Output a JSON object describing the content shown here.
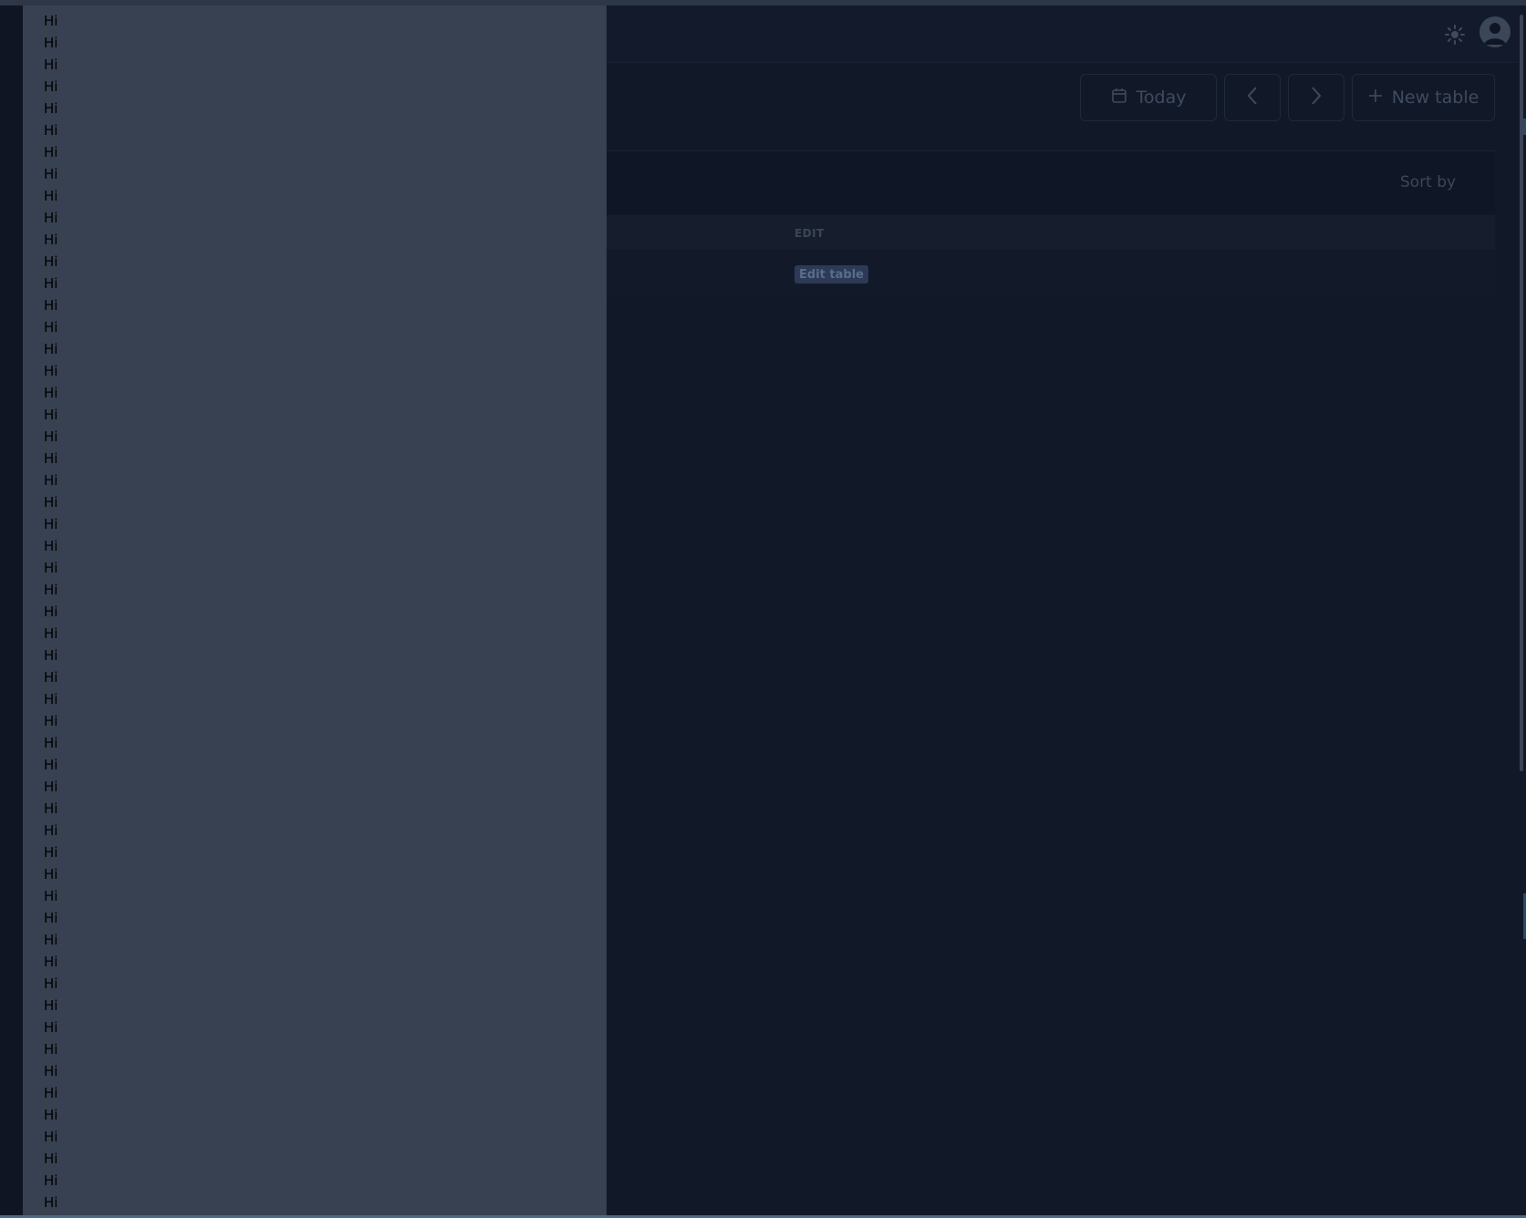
{
  "header": {
    "theme_icon": "sun-icon",
    "avatar_icon": "user-avatar-icon"
  },
  "toolbar": {
    "today_label": "Today",
    "today_icon": "calendar-icon",
    "prev_icon": "chevron-left-icon",
    "next_icon": "chevron-right-icon",
    "new_table_label": "New table",
    "new_table_icon": "plus-icon"
  },
  "list": {
    "sort_label": "Sort by"
  },
  "table": {
    "columns": [
      "EDIT"
    ],
    "rows": [
      {
        "edit_label": "Edit table"
      }
    ]
  },
  "drawer": {
    "items": [
      "Hi",
      "Hi",
      "Hi",
      "Hi",
      "Hi",
      "Hi",
      "Hi",
      "Hi",
      "Hi",
      "Hi",
      "Hi",
      "Hi",
      "Hi",
      "Hi",
      "Hi",
      "Hi",
      "Hi",
      "Hi",
      "Hi",
      "Hi",
      "Hi",
      "Hi",
      "Hi",
      "Hi",
      "Hi",
      "Hi",
      "Hi",
      "Hi",
      "Hi",
      "Hi",
      "Hi",
      "Hi",
      "Hi",
      "Hi",
      "Hi",
      "Hi",
      "Hi",
      "Hi",
      "Hi",
      "Hi",
      "Hi",
      "Hi",
      "Hi",
      "Hi",
      "Hi",
      "Hi",
      "Hi",
      "Hi",
      "Hi",
      "Hi",
      "Hi",
      "Hi",
      "Hi",
      "Hi",
      "Hi"
    ]
  },
  "colors": {
    "background": "#111827",
    "drawer": "#374151",
    "edit_button": "#2c3a56"
  }
}
